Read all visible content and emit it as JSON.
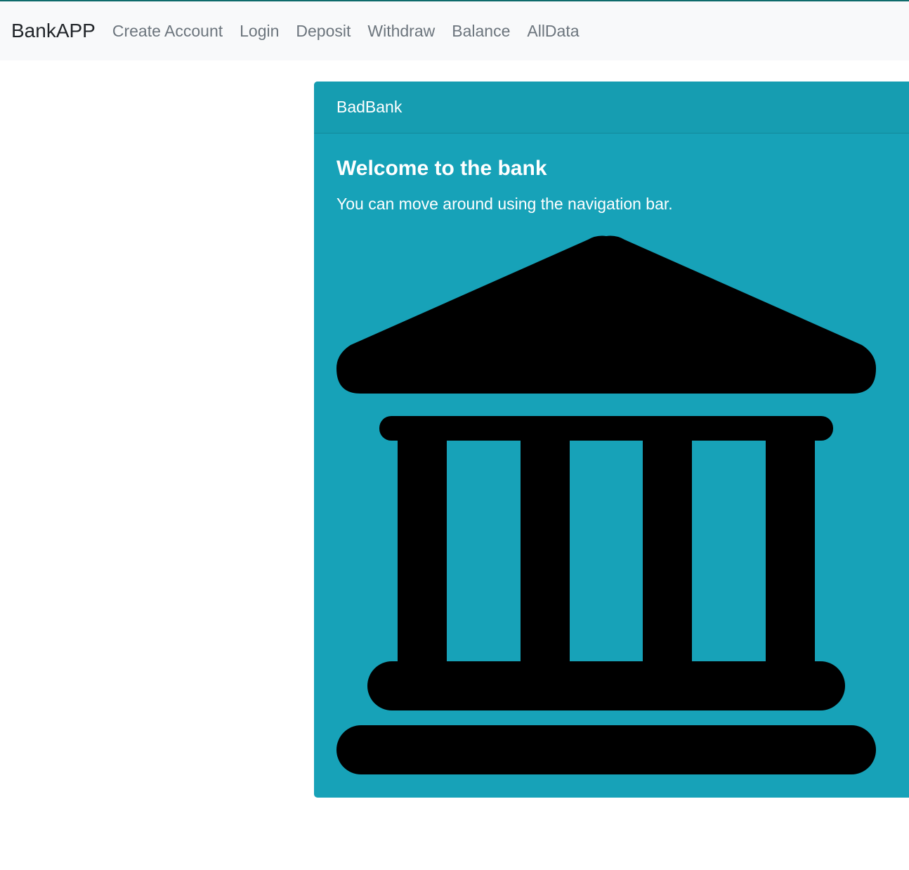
{
  "navbar": {
    "brand": "BankAPP",
    "links": [
      {
        "label": "Create Account"
      },
      {
        "label": "Login"
      },
      {
        "label": "Deposit"
      },
      {
        "label": "Withdraw"
      },
      {
        "label": "Balance"
      },
      {
        "label": "AllData"
      }
    ]
  },
  "card": {
    "header": "BadBank",
    "title": "Welcome to the bank",
    "text": "You can move around using the navigation bar.",
    "image_icon": "bank-building-icon",
    "background_color": "#17a2b8"
  }
}
